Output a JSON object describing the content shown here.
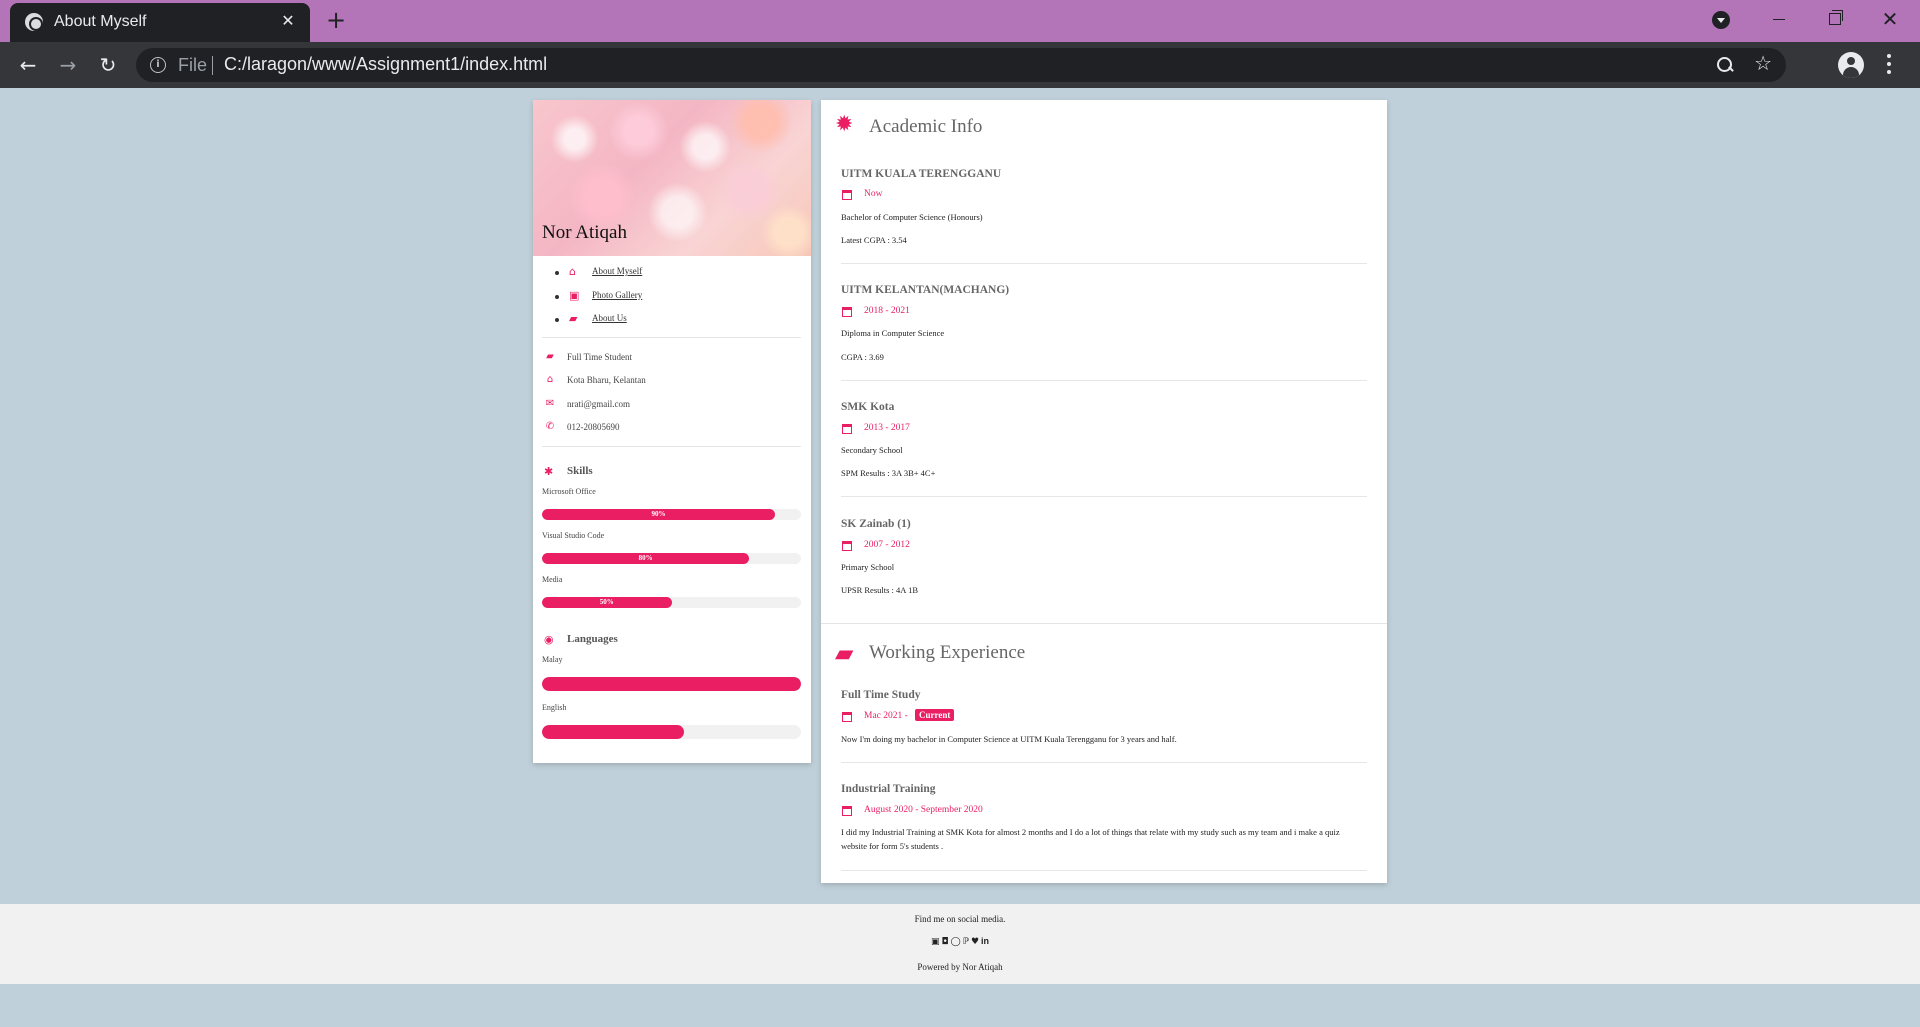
{
  "browser": {
    "tab_title": "About Myself",
    "file_label": "File",
    "url": "C:/laragon/www/Assignment1/index.html"
  },
  "profile": {
    "name": "Nor Atiqah",
    "nav": [
      {
        "label": "About Myself",
        "icon": "home-icon"
      },
      {
        "label": "Photo Gallery",
        "icon": "image-icon"
      },
      {
        "label": "About Us",
        "icon": "briefcase-icon"
      }
    ],
    "info": [
      {
        "text": "Full Time Student",
        "icon": "briefcase-icon"
      },
      {
        "text": "Kota Bharu, Kelantan",
        "icon": "home-icon"
      },
      {
        "text": "nrati@gmail.com",
        "icon": "envelope-icon"
      },
      {
        "text": "012-20805690",
        "icon": "phone-icon"
      }
    ],
    "skills_title": "Skills",
    "skills": [
      {
        "name": "Microsoft Office",
        "percent": 90,
        "label": "90%"
      },
      {
        "name": "Visual Studio Code",
        "percent": 80,
        "label": "80%"
      },
      {
        "name": "Media",
        "percent": 50,
        "label": "50%"
      }
    ],
    "languages_title": "Languages",
    "languages": [
      {
        "name": "Malay",
        "percent": 100
      },
      {
        "name": "English",
        "percent": 55
      }
    ]
  },
  "academic": {
    "title": "Academic Info",
    "entries": [
      {
        "school": "UITM KUALA TERENGGANU",
        "date": "Now",
        "line1": "Bachelor of Computer Science (Honours)",
        "line2": "Latest CGPA : 3.54"
      },
      {
        "school": "UITM KELANTAN(MACHANG)",
        "date": "2018 - 2021",
        "line1": "Diploma in Computer Science",
        "line2": "CGPA : 3.69"
      },
      {
        "school": "SMK Kota",
        "date": "2013 - 2017",
        "line1": "Secondary School",
        "line2": "SPM Results : 3A 3B+ 4C+"
      },
      {
        "school": "SK Zainab (1)",
        "date": "2007 - 2012",
        "line1": "Primary School",
        "line2": "UPSR Results : 4A 1B"
      }
    ]
  },
  "work": {
    "title": "Working Experience",
    "entries": [
      {
        "title": "Full Time Study",
        "date": "Mac 2021 -",
        "badge": "Current",
        "description": "Now I'm doing my bachelor in Computer Science at UITM Kuala Terengganu for 3 years and half."
      },
      {
        "title": "Industrial Training",
        "date": "August 2020 - September 2020",
        "description": "I did my Industrial Training at SMK Kota for almost 2 months and I do a lot of things that relate with my study such as my team and i make a quiz website for form 5's students ."
      }
    ]
  },
  "footer": {
    "text": "Find me on social media.",
    "social": [
      "facebook-icon",
      "instagram-icon",
      "snapchat-icon",
      "pinterest-icon",
      "twitter-icon",
      "linkedin-icon"
    ],
    "powered": "Powered by Nor Atiqah"
  },
  "colors": {
    "accent": "#e91e63",
    "background": "#c0d0da",
    "tabbar": "#b374b8"
  }
}
